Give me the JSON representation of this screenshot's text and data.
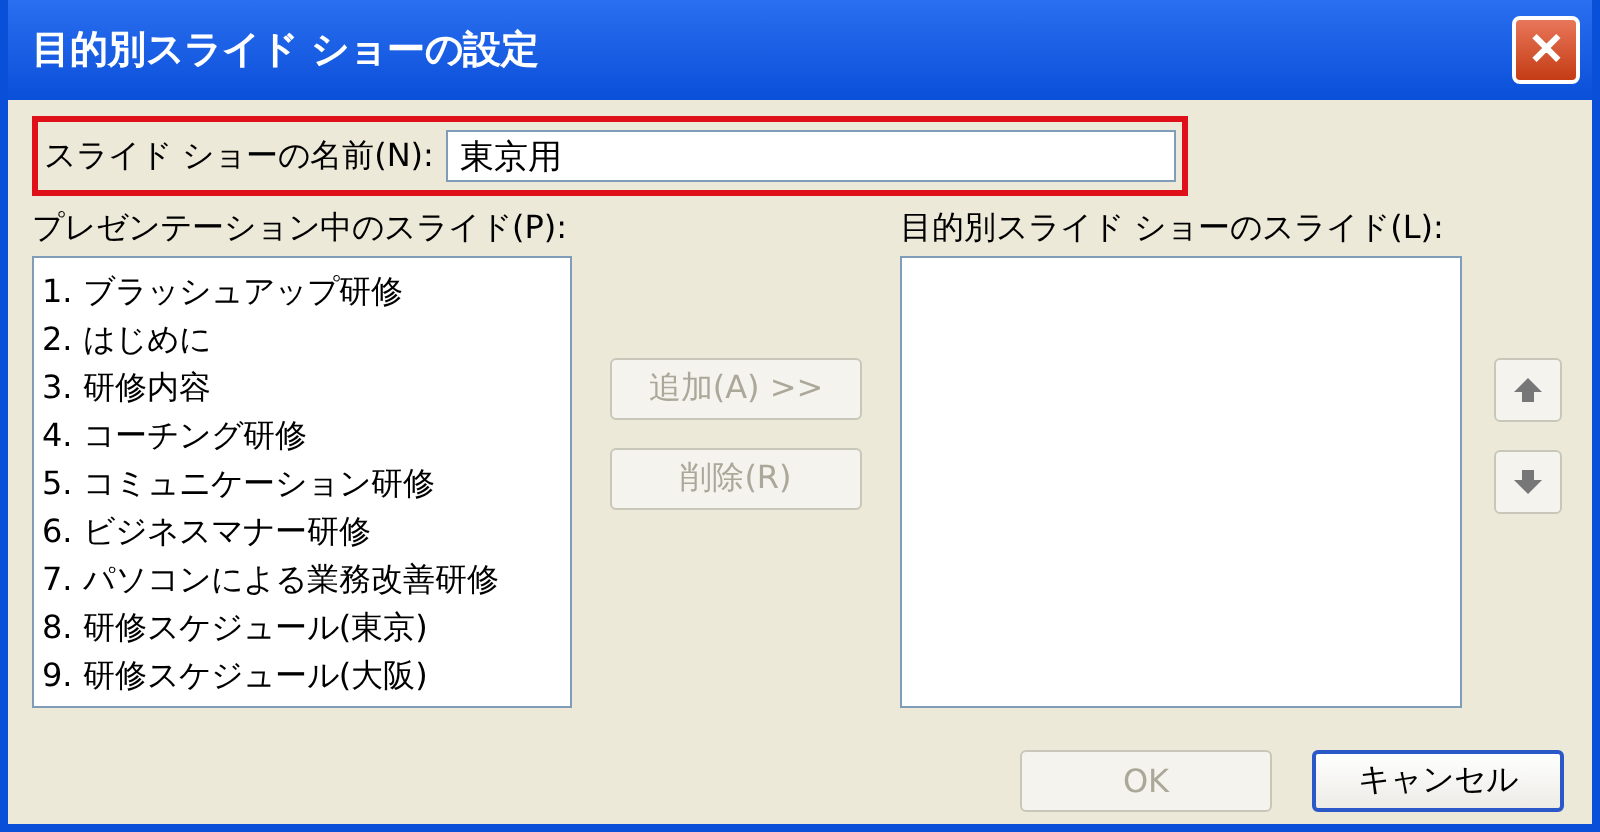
{
  "window": {
    "title": "目的別スライド ショーの設定",
    "close": "✕"
  },
  "name_field": {
    "label": "スライド ショーの名前(N):",
    "value": "東京用",
    "highlighted": true
  },
  "source_list": {
    "label": "プレゼンテーション中のスライド(P):",
    "items": [
      {
        "text": "1. ブラッシュアップ研修"
      },
      {
        "text": "2. はじめに"
      },
      {
        "text": "3. 研修内容"
      },
      {
        "text": "4. コーチング研修"
      },
      {
        "text": "5. コミュニケーション研修"
      },
      {
        "text": "6. ビジネスマナー研修"
      },
      {
        "text": "7. パソコンによる業務改善研修"
      },
      {
        "text": "8. 研修スケジュール(東京)"
      },
      {
        "text": "9. 研修スケジュール(大阪)"
      }
    ]
  },
  "move_buttons": [
    {
      "label": "追加(A) >>",
      "disabled": true
    },
    {
      "label": "削除(R)",
      "disabled": true
    }
  ],
  "target_list": {
    "label": "目的別スライド ショーのスライド(L):"
  },
  "order_buttons": [
    {
      "kind": "up"
    },
    {
      "kind": "down"
    }
  ],
  "buttons": [
    {
      "label": "OK",
      "disabled": true,
      "default": false
    },
    {
      "label": "キャンセル",
      "disabled": false,
      "default": true
    }
  ]
}
